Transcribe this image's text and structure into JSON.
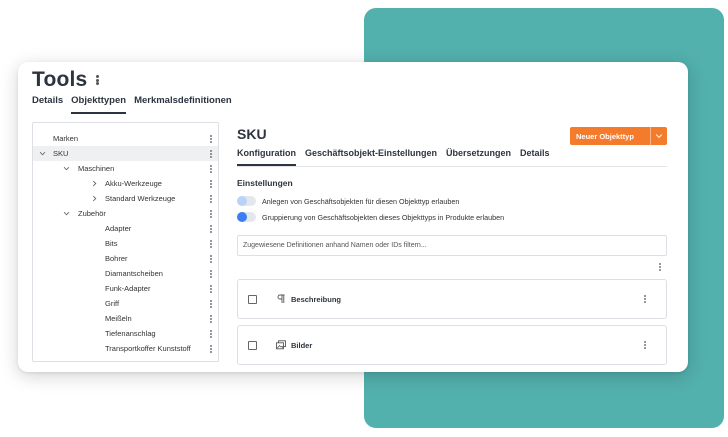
{
  "app": {
    "title": "Tools",
    "tabs": [
      {
        "label": "Details"
      },
      {
        "label": "Objekttypen"
      },
      {
        "label": "Merkmalsdefinitionen"
      }
    ]
  },
  "tree": {
    "items": [
      {
        "label": "Marken"
      },
      {
        "label": "SKU"
      },
      {
        "label": "Maschinen"
      },
      {
        "label": "Akku-Werkzeuge"
      },
      {
        "label": "Standard Werkzeuge"
      },
      {
        "label": "Zubehör"
      },
      {
        "label": "Adapter"
      },
      {
        "label": "Bits"
      },
      {
        "label": "Bohrer"
      },
      {
        "label": "Diamantscheiben"
      },
      {
        "label": "Funk-Adapter"
      },
      {
        "label": "Griff"
      },
      {
        "label": "Meißeln"
      },
      {
        "label": "Tiefenanschlag"
      },
      {
        "label": "Transportkoffer Kunststoff"
      }
    ]
  },
  "detail": {
    "title": "SKU",
    "new_button_label": "Neuer Objekttyp",
    "tabs": [
      {
        "label": "Konfiguration"
      },
      {
        "label": "Geschäftsobjekt-Einstellungen"
      },
      {
        "label": "Übersetzungen"
      },
      {
        "label": "Details"
      }
    ],
    "settings_title": "Einstellungen",
    "settings": [
      {
        "label": "Anlegen von Geschäftsobjekten für diesen Objekttyp erlauben"
      },
      {
        "label": "Gruppierung von Geschäftsobjekten dieses Objekttyps in Produkte erlauben"
      }
    ],
    "filter_placeholder": "Zugewiesene Definitionen anhand Namen oder IDs filtern...",
    "definitions": [
      {
        "label": "Beschreibung",
        "icon": "paragraph-icon"
      },
      {
        "label": "Bilder",
        "icon": "images-icon"
      }
    ]
  },
  "colors": {
    "accent": "#f47b2c",
    "teal": "#52b0ad",
    "toggle_on": "#3d7ef0"
  }
}
